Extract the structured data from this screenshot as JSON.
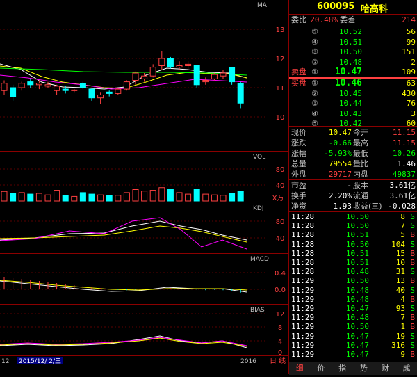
{
  "stock": {
    "code": "600095",
    "name": "哈高科"
  },
  "chart": {
    "ma_label": "MA",
    "price_ticks": [
      "13",
      "12",
      "11",
      "10"
    ],
    "vol_label": "VOL",
    "vol_ticks": [
      "80",
      "40"
    ],
    "vol_unit": "X万",
    "kdj_label": "KDJ",
    "kdj_ticks": [
      "80",
      "40"
    ],
    "macd_label": "MACD",
    "macd_ticks": [
      "0.4",
      "0.0"
    ],
    "bias_label": "BIAS",
    "bias_ticks": [
      "12",
      "8",
      "4",
      "0"
    ],
    "date_left": "12",
    "date_cursor": "2015/12/ 2/三",
    "date_right": "2016",
    "date_label": "日 线"
  },
  "chart_data": {
    "type": "candlestick",
    "candles": [
      {
        "o": 10.9,
        "h": 11.25,
        "l": 10.75,
        "c": 11.15,
        "up": true,
        "v": 25
      },
      {
        "o": 11.0,
        "h": 11.1,
        "l": 10.55,
        "c": 10.7,
        "up": false,
        "v": 20
      },
      {
        "o": 11.0,
        "h": 11.2,
        "l": 10.9,
        "c": 11.15,
        "up": true,
        "v": 22
      },
      {
        "o": 11.2,
        "h": 11.3,
        "l": 11.0,
        "c": 11.1,
        "up": false,
        "v": 18
      },
      {
        "o": 11.1,
        "h": 11.25,
        "l": 10.95,
        "c": 11.15,
        "up": true,
        "v": 20
      },
      {
        "o": 11.1,
        "h": 11.2,
        "l": 11.0,
        "c": 11.05,
        "up": true,
        "v": 16
      },
      {
        "o": 10.9,
        "h": 11.1,
        "l": 10.75,
        "c": 11.05,
        "up": true,
        "v": 28
      },
      {
        "o": 10.95,
        "h": 11.05,
        "l": 10.8,
        "c": 10.9,
        "up": false,
        "v": 15
      },
      {
        "o": 10.9,
        "h": 10.95,
        "l": 10.85,
        "c": 10.92,
        "up": true,
        "v": 12
      },
      {
        "o": 11.15,
        "h": 11.2,
        "l": 10.95,
        "c": 11.0,
        "up": false,
        "v": 22
      },
      {
        "o": 10.95,
        "h": 11.0,
        "l": 10.55,
        "c": 10.65,
        "up": false,
        "v": 18
      },
      {
        "o": 10.65,
        "h": 10.85,
        "l": 10.45,
        "c": 10.75,
        "up": true,
        "v": 16
      },
      {
        "o": 10.85,
        "h": 10.9,
        "l": 10.7,
        "c": 10.8,
        "up": false,
        "v": 14
      },
      {
        "o": 10.8,
        "h": 11.0,
        "l": 10.75,
        "c": 10.95,
        "up": true,
        "v": 15
      },
      {
        "o": 10.95,
        "h": 11.25,
        "l": 10.9,
        "c": 11.2,
        "up": true,
        "v": 22
      },
      {
        "o": 11.25,
        "h": 11.55,
        "l": 11.1,
        "c": 11.5,
        "up": true,
        "v": 30
      },
      {
        "o": 11.4,
        "h": 11.5,
        "l": 11.2,
        "c": 11.3,
        "up": true,
        "v": 26
      },
      {
        "o": 11.4,
        "h": 11.8,
        "l": 11.35,
        "c": 11.7,
        "up": true,
        "v": 28
      },
      {
        "o": 11.75,
        "h": 12.25,
        "l": 11.6,
        "c": 12.0,
        "up": true,
        "v": 35
      },
      {
        "o": 12.0,
        "h": 12.05,
        "l": 11.65,
        "c": 11.7,
        "up": false,
        "v": 30
      },
      {
        "o": 11.75,
        "h": 11.9,
        "l": 11.6,
        "c": 11.7,
        "up": true,
        "v": 22
      },
      {
        "o": 11.8,
        "h": 11.9,
        "l": 11.65,
        "c": 11.75,
        "up": true,
        "v": 18
      },
      {
        "o": 11.75,
        "h": 11.75,
        "l": 11.0,
        "c": 11.1,
        "up": false,
        "v": 30
      },
      {
        "o": 11.2,
        "h": 11.35,
        "l": 11.1,
        "c": 11.25,
        "up": true,
        "v": 18
      },
      {
        "o": 11.3,
        "h": 11.5,
        "l": 11.25,
        "c": 11.45,
        "up": true,
        "v": 16
      },
      {
        "o": 11.5,
        "h": 11.6,
        "l": 11.3,
        "c": 11.4,
        "up": true,
        "v": 15
      },
      {
        "o": 11.7,
        "h": 11.7,
        "l": 11.1,
        "c": 11.2,
        "up": false,
        "v": 20
      },
      {
        "o": 11.15,
        "h": 11.2,
        "l": 10.3,
        "c": 10.47,
        "up": false,
        "v": 25
      }
    ],
    "macd_hist": [
      0.3,
      0.28,
      0.25,
      0.23,
      0.2,
      0.18,
      0.15,
      0.12,
      0.1,
      0.08,
      0.05,
      0.03,
      0.01,
      -0.01,
      -0.02,
      -0.01,
      0.0,
      0.01,
      0.02,
      0.03,
      0.02,
      0.01,
      -0.01,
      -0.02,
      -0.01,
      -0.02,
      -0.03,
      -0.08
    ]
  },
  "quote": {
    "weibi_label": "委比",
    "weibi": "20.48%",
    "weicha_label": "委差",
    "weicha": "214",
    "sell_label": "卖盘",
    "buy_label": "买盘",
    "sells": [
      {
        "idx": "⑤",
        "price": "10.52",
        "vol": "56"
      },
      {
        "idx": "④",
        "price": "10.51",
        "vol": "99"
      },
      {
        "idx": "③",
        "price": "10.50",
        "vol": "151"
      },
      {
        "idx": "②",
        "price": "10.48",
        "vol": "2"
      },
      {
        "idx": "①",
        "price": "10.47",
        "vol": "109"
      }
    ],
    "buys": [
      {
        "idx": "①",
        "price": "10.46",
        "vol": "63"
      },
      {
        "idx": "②",
        "price": "10.45",
        "vol": "430"
      },
      {
        "idx": "③",
        "price": "10.44",
        "vol": "76"
      },
      {
        "idx": "④",
        "price": "10.43",
        "vol": "3"
      },
      {
        "idx": "⑤",
        "price": "10.42",
        "vol": "60"
      }
    ],
    "stats": [
      {
        "l1": "现价",
        "v1": "10.47",
        "l2": "今开",
        "v2": "11.15",
        "c1": "#ffff00",
        "c2": "#ff4040"
      },
      {
        "l1": "涨跌",
        "v1": "-0.66",
        "l2": "最高",
        "v2": "11.15",
        "c1": "#00ff00",
        "c2": "#ff4040"
      },
      {
        "l1": "涨幅",
        "v1": "-5.93%",
        "l2": "最低",
        "v2": "10.26",
        "c1": "#00ff00",
        "c2": "#00ff00"
      },
      {
        "l1": "总量",
        "v1": "79554",
        "l2": "量比",
        "v2": "1.46",
        "c1": "#ffff00",
        "c2": "#ffffff"
      },
      {
        "l1": "外盘",
        "v1": "29717",
        "l2": "内盘",
        "v2": "49837",
        "c1": "#ff4040",
        "c2": "#00ff00"
      }
    ],
    "fund": [
      {
        "l1": "市盈",
        "v1": "-",
        "l2": "股本",
        "v2": "3.61亿"
      },
      {
        "l1": "换手",
        "v1": "2.20%",
        "l2": "流通",
        "v2": "3.61亿"
      },
      {
        "l1": "净资",
        "v1": "1.93",
        "l2": "收益(三)",
        "v2": "-0.028"
      }
    ],
    "ticks": [
      {
        "t": "11:28",
        "p": "10.50",
        "v": "8",
        "d": "S"
      },
      {
        "t": "11:28",
        "p": "10.50",
        "v": "7",
        "d": "S"
      },
      {
        "t": "11:28",
        "p": "10.51",
        "v": "5",
        "d": "B"
      },
      {
        "t": "11:28",
        "p": "10.50",
        "v": "104",
        "d": "S"
      },
      {
        "t": "11:28",
        "p": "10.51",
        "v": "15",
        "d": "B"
      },
      {
        "t": "11:28",
        "p": "10.51",
        "v": "10",
        "d": "B"
      },
      {
        "t": "11:28",
        "p": "10.48",
        "v": "31",
        "d": "S"
      },
      {
        "t": "11:29",
        "p": "10.50",
        "v": "13",
        "d": "B"
      },
      {
        "t": "11:29",
        "p": "10.48",
        "v": "40",
        "d": "S"
      },
      {
        "t": "11:29",
        "p": "10.48",
        "v": "4",
        "d": "B"
      },
      {
        "t": "11:29",
        "p": "10.47",
        "v": "93",
        "d": "S"
      },
      {
        "t": "11:29",
        "p": "10.48",
        "v": "7",
        "d": "B"
      },
      {
        "t": "11:29",
        "p": "10.50",
        "v": "1",
        "d": "B"
      },
      {
        "t": "11:29",
        "p": "10.47",
        "v": "19",
        "d": "S"
      },
      {
        "t": "11:29",
        "p": "10.47",
        "v": "316",
        "d": "S"
      },
      {
        "t": "11:29",
        "p": "10.47",
        "v": "9",
        "d": "B"
      }
    ],
    "tabs": [
      "细",
      "价",
      "指",
      "势",
      "财",
      "成"
    ]
  }
}
